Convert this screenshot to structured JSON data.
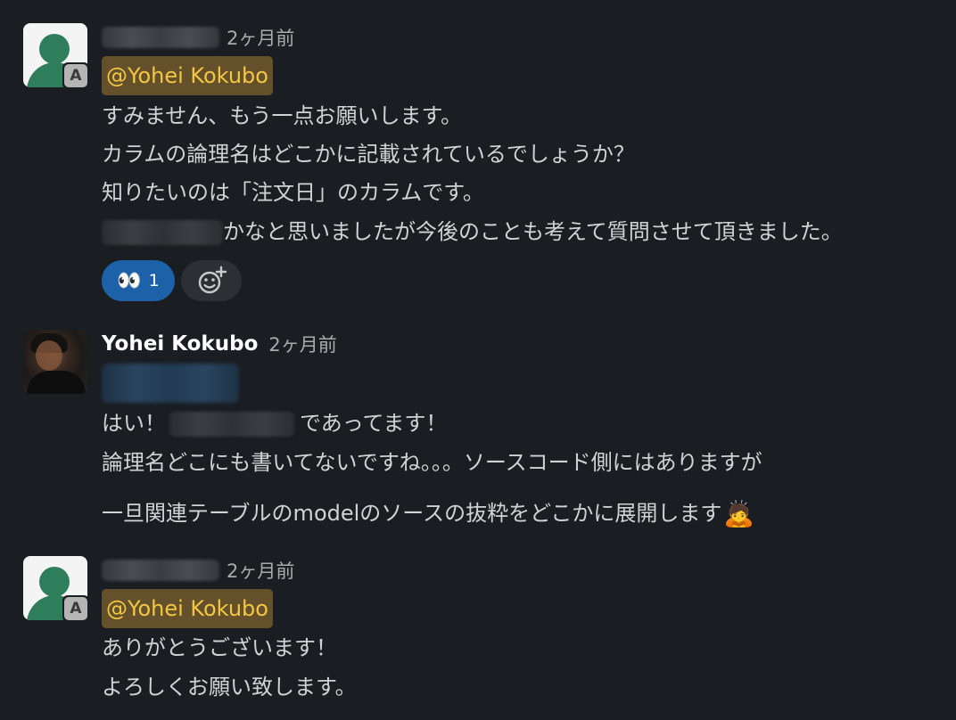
{
  "messages": [
    {
      "time": "2ヶ月前",
      "app_badge": "A",
      "mention": "@Yohei Kokubo",
      "lines": [
        "すみません、もう一点お願いします。",
        "カラムの論理名はどこかに記載されているでしょうか？",
        "知りたいのは「注文日」のカラムです。",
        "かなと思いましたが今後のことも考えて質問させて頂きました。"
      ],
      "reactions": [
        {
          "emoji": "👀",
          "count": "1"
        }
      ]
    },
    {
      "author": "Yohei Kokubo",
      "time": "2ヶ月前",
      "lines": [
        "はい！",
        "であってます！",
        "論理名どこにも書いてないですね。。。ソースコード側にはありますが",
        "一旦関連テーブルのmodelのソースの抜粋をどこかに展開します"
      ],
      "inline_emoji": "🙇"
    },
    {
      "time": "2ヶ月前",
      "app_badge": "A",
      "mention": "@Yohei Kokubo",
      "lines": [
        "ありがとうございます！",
        "よろしくお願い致します。"
      ]
    }
  ],
  "icons": {
    "add_reaction": "add-reaction-icon",
    "generic_avatar": "user-avatar-icon"
  },
  "colors": {
    "background": "#1a1d21",
    "mention_bg": "#64502a",
    "mention_text": "#f2c744",
    "reaction_active": "#1d62a8",
    "avatar_green": "#2e7d5b"
  }
}
